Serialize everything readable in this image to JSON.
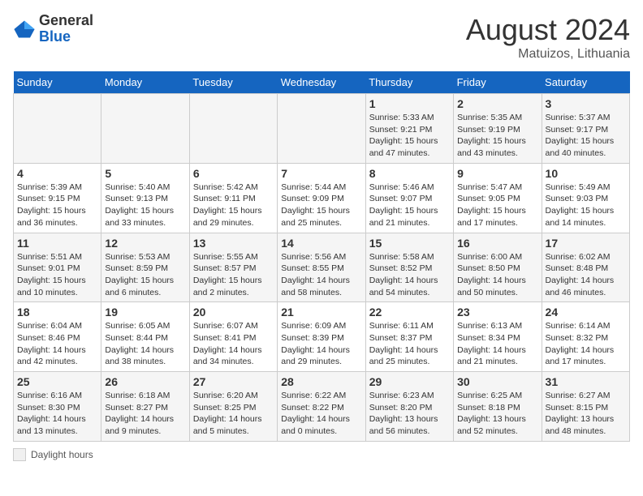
{
  "logo": {
    "general": "General",
    "blue": "Blue"
  },
  "title": "August 2024",
  "subtitle": "Matuizos, Lithuania",
  "days_of_week": [
    "Sunday",
    "Monday",
    "Tuesday",
    "Wednesday",
    "Thursday",
    "Friday",
    "Saturday"
  ],
  "legend_label": "Daylight hours",
  "weeks": [
    [
      {
        "day": "",
        "sunrise": "",
        "sunset": "",
        "daylight": ""
      },
      {
        "day": "",
        "sunrise": "",
        "sunset": "",
        "daylight": ""
      },
      {
        "day": "",
        "sunrise": "",
        "sunset": "",
        "daylight": ""
      },
      {
        "day": "",
        "sunrise": "",
        "sunset": "",
        "daylight": ""
      },
      {
        "day": "1",
        "sunrise": "Sunrise: 5:33 AM",
        "sunset": "Sunset: 9:21 PM",
        "daylight": "Daylight: 15 hours and 47 minutes."
      },
      {
        "day": "2",
        "sunrise": "Sunrise: 5:35 AM",
        "sunset": "Sunset: 9:19 PM",
        "daylight": "Daylight: 15 hours and 43 minutes."
      },
      {
        "day": "3",
        "sunrise": "Sunrise: 5:37 AM",
        "sunset": "Sunset: 9:17 PM",
        "daylight": "Daylight: 15 hours and 40 minutes."
      }
    ],
    [
      {
        "day": "4",
        "sunrise": "Sunrise: 5:39 AM",
        "sunset": "Sunset: 9:15 PM",
        "daylight": "Daylight: 15 hours and 36 minutes."
      },
      {
        "day": "5",
        "sunrise": "Sunrise: 5:40 AM",
        "sunset": "Sunset: 9:13 PM",
        "daylight": "Daylight: 15 hours and 33 minutes."
      },
      {
        "day": "6",
        "sunrise": "Sunrise: 5:42 AM",
        "sunset": "Sunset: 9:11 PM",
        "daylight": "Daylight: 15 hours and 29 minutes."
      },
      {
        "day": "7",
        "sunrise": "Sunrise: 5:44 AM",
        "sunset": "Sunset: 9:09 PM",
        "daylight": "Daylight: 15 hours and 25 minutes."
      },
      {
        "day": "8",
        "sunrise": "Sunrise: 5:46 AM",
        "sunset": "Sunset: 9:07 PM",
        "daylight": "Daylight: 15 hours and 21 minutes."
      },
      {
        "day": "9",
        "sunrise": "Sunrise: 5:47 AM",
        "sunset": "Sunset: 9:05 PM",
        "daylight": "Daylight: 15 hours and 17 minutes."
      },
      {
        "day": "10",
        "sunrise": "Sunrise: 5:49 AM",
        "sunset": "Sunset: 9:03 PM",
        "daylight": "Daylight: 15 hours and 14 minutes."
      }
    ],
    [
      {
        "day": "11",
        "sunrise": "Sunrise: 5:51 AM",
        "sunset": "Sunset: 9:01 PM",
        "daylight": "Daylight: 15 hours and 10 minutes."
      },
      {
        "day": "12",
        "sunrise": "Sunrise: 5:53 AM",
        "sunset": "Sunset: 8:59 PM",
        "daylight": "Daylight: 15 hours and 6 minutes."
      },
      {
        "day": "13",
        "sunrise": "Sunrise: 5:55 AM",
        "sunset": "Sunset: 8:57 PM",
        "daylight": "Daylight: 15 hours and 2 minutes."
      },
      {
        "day": "14",
        "sunrise": "Sunrise: 5:56 AM",
        "sunset": "Sunset: 8:55 PM",
        "daylight": "Daylight: 14 hours and 58 minutes."
      },
      {
        "day": "15",
        "sunrise": "Sunrise: 5:58 AM",
        "sunset": "Sunset: 8:52 PM",
        "daylight": "Daylight: 14 hours and 54 minutes."
      },
      {
        "day": "16",
        "sunrise": "Sunrise: 6:00 AM",
        "sunset": "Sunset: 8:50 PM",
        "daylight": "Daylight: 14 hours and 50 minutes."
      },
      {
        "day": "17",
        "sunrise": "Sunrise: 6:02 AM",
        "sunset": "Sunset: 8:48 PM",
        "daylight": "Daylight: 14 hours and 46 minutes."
      }
    ],
    [
      {
        "day": "18",
        "sunrise": "Sunrise: 6:04 AM",
        "sunset": "Sunset: 8:46 PM",
        "daylight": "Daylight: 14 hours and 42 minutes."
      },
      {
        "day": "19",
        "sunrise": "Sunrise: 6:05 AM",
        "sunset": "Sunset: 8:44 PM",
        "daylight": "Daylight: 14 hours and 38 minutes."
      },
      {
        "day": "20",
        "sunrise": "Sunrise: 6:07 AM",
        "sunset": "Sunset: 8:41 PM",
        "daylight": "Daylight: 14 hours and 34 minutes."
      },
      {
        "day": "21",
        "sunrise": "Sunrise: 6:09 AM",
        "sunset": "Sunset: 8:39 PM",
        "daylight": "Daylight: 14 hours and 29 minutes."
      },
      {
        "day": "22",
        "sunrise": "Sunrise: 6:11 AM",
        "sunset": "Sunset: 8:37 PM",
        "daylight": "Daylight: 14 hours and 25 minutes."
      },
      {
        "day": "23",
        "sunrise": "Sunrise: 6:13 AM",
        "sunset": "Sunset: 8:34 PM",
        "daylight": "Daylight: 14 hours and 21 minutes."
      },
      {
        "day": "24",
        "sunrise": "Sunrise: 6:14 AM",
        "sunset": "Sunset: 8:32 PM",
        "daylight": "Daylight: 14 hours and 17 minutes."
      }
    ],
    [
      {
        "day": "25",
        "sunrise": "Sunrise: 6:16 AM",
        "sunset": "Sunset: 8:30 PM",
        "daylight": "Daylight: 14 hours and 13 minutes."
      },
      {
        "day": "26",
        "sunrise": "Sunrise: 6:18 AM",
        "sunset": "Sunset: 8:27 PM",
        "daylight": "Daylight: 14 hours and 9 minutes."
      },
      {
        "day": "27",
        "sunrise": "Sunrise: 6:20 AM",
        "sunset": "Sunset: 8:25 PM",
        "daylight": "Daylight: 14 hours and 5 minutes."
      },
      {
        "day": "28",
        "sunrise": "Sunrise: 6:22 AM",
        "sunset": "Sunset: 8:22 PM",
        "daylight": "Daylight: 14 hours and 0 minutes."
      },
      {
        "day": "29",
        "sunrise": "Sunrise: 6:23 AM",
        "sunset": "Sunset: 8:20 PM",
        "daylight": "Daylight: 13 hours and 56 minutes."
      },
      {
        "day": "30",
        "sunrise": "Sunrise: 6:25 AM",
        "sunset": "Sunset: 8:18 PM",
        "daylight": "Daylight: 13 hours and 52 minutes."
      },
      {
        "day": "31",
        "sunrise": "Sunrise: 6:27 AM",
        "sunset": "Sunset: 8:15 PM",
        "daylight": "Daylight: 13 hours and 48 minutes."
      }
    ]
  ]
}
